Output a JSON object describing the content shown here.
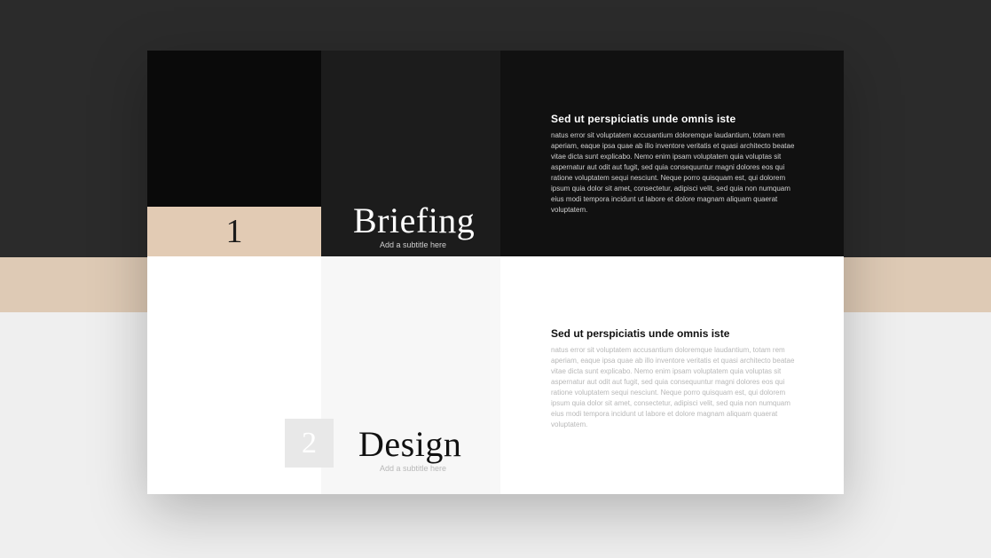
{
  "sections": [
    {
      "number": "1",
      "title": "Briefing",
      "subtitle": "Add a subtitle here",
      "heading": "Sed ut perspiciatis unde omnis iste",
      "body": "natus error sit voluptatem accusantium doloremque laudantium, totam rem aperiam, eaque ipsa quae ab illo inventore veritatis et quasi architecto beatae vitae dicta sunt explicabo. Nemo enim ipsam voluptatem quia voluptas sit aspernatur aut odit aut fugit, sed quia consequuntur magni dolores eos qui ratione voluptatem sequi nesciunt. Neque porro quisquam est, qui dolorem ipsum quia dolor sit amet, consectetur, adipisci velit, sed quia non numquam eius modi tempora incidunt ut labore et dolore magnam aliquam quaerat voluptatem."
    },
    {
      "number": "2",
      "title": "Design",
      "subtitle": "Add a subtitle here",
      "heading": "Sed ut perspiciatis unde omnis iste",
      "body": "natus error sit voluptatem accusantium doloremque laudantium, totam rem aperiam, eaque ipsa quae ab illo inventore veritatis et quasi architecto beatae vitae dicta sunt explicabo. Nemo enim ipsam voluptatem quia voluptas sit aspernatur aut odit aut fugit, sed quia consequuntur magni dolores eos qui ratione voluptatem sequi nesciunt. Neque porro quisquam est, qui dolorem ipsum quia dolor sit amet, consectetur, adipisci velit, sed quia non numquam eius modi tempora incidunt ut labore et dolore magnam aliquam quaerat voluptatem."
    }
  ],
  "colors": {
    "dark": "#111111",
    "dark_alt": "#1c1c1c",
    "tan": "#e2cbb4",
    "light_grey": "#e8e8e8"
  }
}
